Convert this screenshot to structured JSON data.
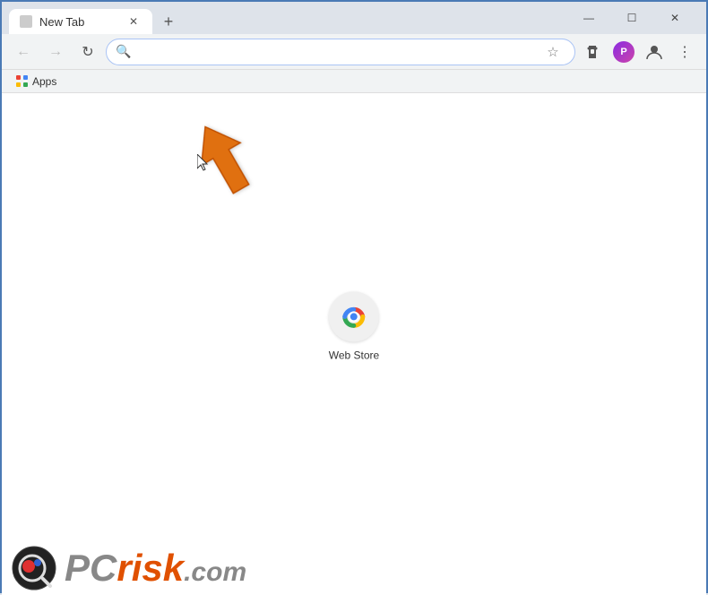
{
  "window": {
    "title": "New Tab",
    "border_color": "#4a7ab5"
  },
  "titlebar": {
    "tab_label": "New Tab",
    "new_tab_symbol": "+",
    "minimize_label": "—",
    "maximize_label": "☐",
    "close_label": "✕"
  },
  "navbar": {
    "back_symbol": "←",
    "forward_symbol": "→",
    "reload_symbol": "↻",
    "search_symbol": "🔍",
    "address_placeholder": "",
    "star_symbol": "☆",
    "menu_symbol": "⋮"
  },
  "bookmarks": {
    "apps_label": "Apps"
  },
  "new_tab": {
    "web_store_label": "Web Store"
  },
  "pcrisk": {
    "pc_text": "PC",
    "risk_text": "risk",
    "com_text": ".com"
  },
  "colors": {
    "orange_arrow": "#e07010",
    "chrome_blue": "#4285f4",
    "chrome_red": "#ea4335",
    "chrome_yellow": "#fbbc04",
    "chrome_green": "#34a853"
  }
}
